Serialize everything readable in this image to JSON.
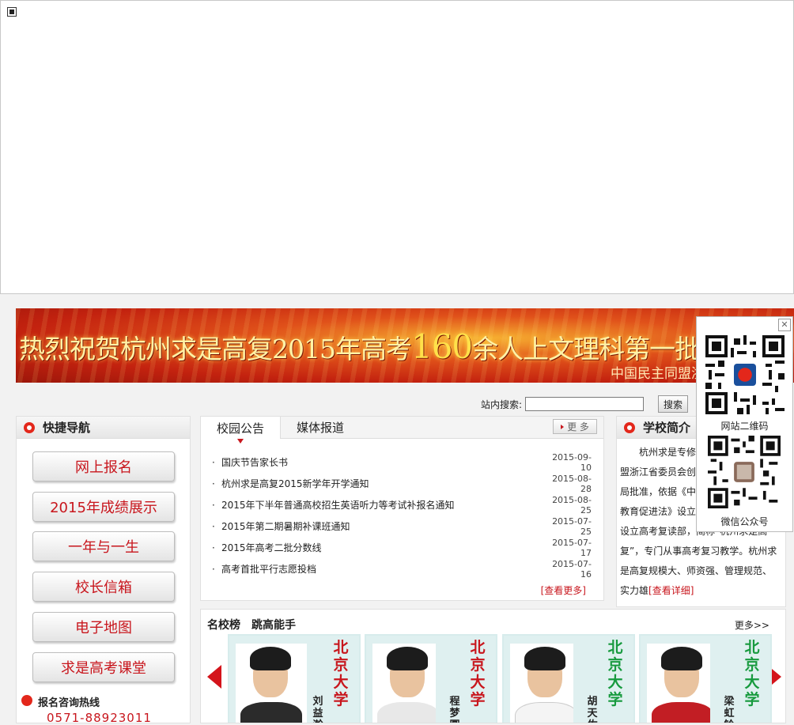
{
  "banner": {
    "headline_pre": "热烈祝贺杭州求是高复2015年高考",
    "headline_num": "160",
    "headline_post": "余人上文理科第一批",
    "subline": "中国民主同盟浙江省"
  },
  "search": {
    "label": "站内搜索:",
    "value": "",
    "button": "搜索"
  },
  "quick_nav": {
    "title": "快捷导航",
    "items": [
      "网上报名",
      "2015年成绩展示",
      "一年与一生",
      "校长信箱",
      "电子地图",
      "求是高考课堂"
    ],
    "hotline_title": "报名咨询热线",
    "hotline_number": "0571-88923011"
  },
  "news": {
    "tabs": [
      "校园公告",
      "媒体报道"
    ],
    "more": "更 多",
    "items": [
      {
        "title": "国庆节告家长书",
        "date": "2015-09-10"
      },
      {
        "title": "杭州求是高复2015新学年开学通知",
        "date": "2015-08-28"
      },
      {
        "title": "2015年下半年普通高校招生英语听力等考试补报名通知",
        "date": "2015-08-25"
      },
      {
        "title": "2015年第二期暑期补课班通知",
        "date": "2015-07-25"
      },
      {
        "title": "2015年高考二批分数线",
        "date": "2015-07-17"
      },
      {
        "title": "高考首批平行志愿投档",
        "date": "2015-07-16"
      }
    ],
    "view_more": "[查看更多]"
  },
  "intro": {
    "title": "学校简介",
    "text": "　　杭州求是专修学校是中国民主同盟浙江省委员会创办，经杭州市教育局批准，依据《中华人民共和国民办教育促进法》设立的学校。1996年起设立高考复读部，简称“杭州求是高复”，专门从事高考复习教学。杭州求是高复规模大、师资强、管理规范、实力雄",
    "detail": "[查看详细]"
  },
  "honor": {
    "tabs": [
      "名校榜",
      "跳高能手"
    ],
    "more": "更多>>",
    "cards": [
      {
        "university": "北京大学",
        "name": "刘益瀚",
        "color": "#c8161d"
      },
      {
        "university": "北京大学",
        "name": "程梦圆",
        "color": "#c8161d"
      },
      {
        "university": "北京大学",
        "name": "胡天佐",
        "color": "#179a3e"
      },
      {
        "university": "北京大学",
        "name": "梁虹铃",
        "color": "#179a3e"
      }
    ]
  },
  "qr": {
    "site_label": "网站二维码",
    "wechat_label": "微信公众号",
    "close": "✕"
  }
}
